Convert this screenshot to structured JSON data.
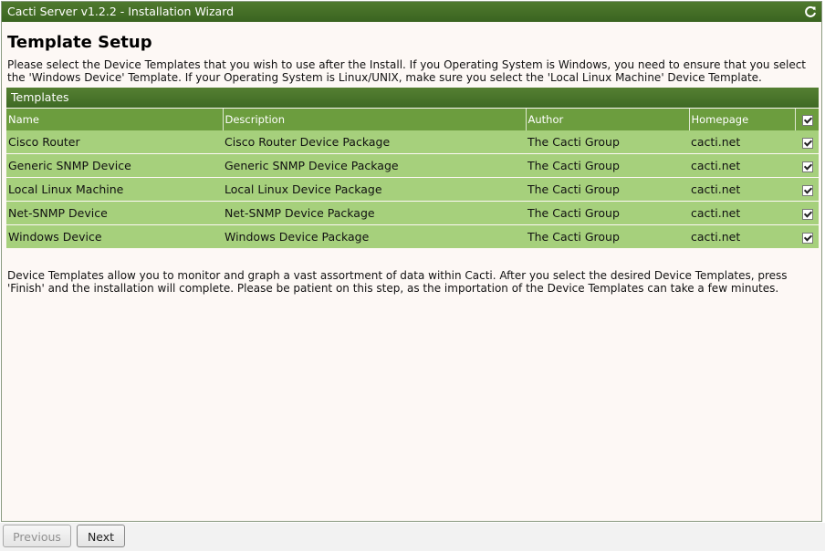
{
  "window": {
    "title": "Cacti Server v1.2.2 - Installation Wizard"
  },
  "page": {
    "heading": "Template Setup",
    "intro": "Please select the Device Templates that you wish to use after the Install. If you Operating System is Windows, you need to ensure that you select the 'Windows Device' Template. If your Operating System is Linux/UNIX, make sure you select the 'Local Linux Machine' Device Template.",
    "outro": "Device Templates allow you to monitor and graph a vast assortment of data within Cacti. After you select the desired Device Templates, press 'Finish' and the installation will complete. Please be patient on this step, as the importation of the Device Templates can take a few minutes."
  },
  "templates": {
    "section_title": "Templates",
    "columns": [
      "Name",
      "Description",
      "Author",
      "Homepage"
    ],
    "select_all_checked": true,
    "rows": [
      {
        "name": "Cisco Router",
        "description": "Cisco Router Device Package",
        "author": "The Cacti Group",
        "homepage": "cacti.net",
        "checked": true
      },
      {
        "name": "Generic SNMP Device",
        "description": "Generic SNMP Device Package",
        "author": "The Cacti Group",
        "homepage": "cacti.net",
        "checked": true
      },
      {
        "name": "Local Linux Machine",
        "description": "Local Linux Device Package",
        "author": "The Cacti Group",
        "homepage": "cacti.net",
        "checked": true
      },
      {
        "name": "Net-SNMP Device",
        "description": "Net-SNMP Device Package",
        "author": "The Cacti Group",
        "homepage": "cacti.net",
        "checked": true
      },
      {
        "name": "Windows Device",
        "description": "Windows Device Package",
        "author": "The Cacti Group",
        "homepage": "cacti.net",
        "checked": true
      }
    ]
  },
  "buttons": {
    "previous": "Previous",
    "next": "Next"
  },
  "icons": {
    "refresh": "refresh-icon",
    "checkbox": "checkbox-icon"
  },
  "colors": {
    "titlebar": "#3f6a24",
    "header_row": "#6c9d3e",
    "data_row": "#a6d07c",
    "background": "#fdf8f5"
  }
}
